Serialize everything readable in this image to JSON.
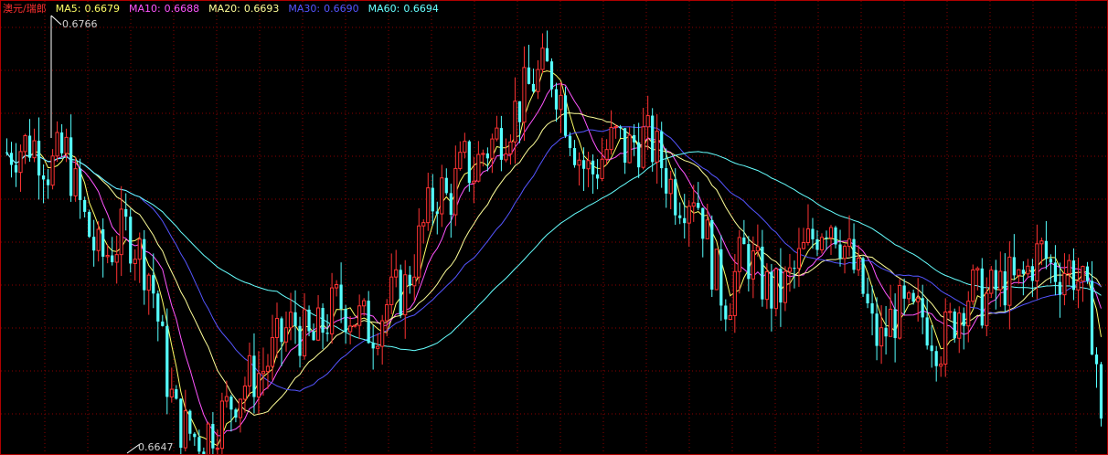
{
  "legend": {
    "symbol": "澳元/瑞郎",
    "ma5_label": "MA5:",
    "ma5_value": "0.6679",
    "ma10_label": "MA10:",
    "ma10_value": "0.6688",
    "ma20_label": "MA20:",
    "ma20_value": "0.6693",
    "ma30_label": "MA30:",
    "ma30_value": "0.6690",
    "ma60_label": "MA60:",
    "ma60_value": "0.6694"
  },
  "annotations": {
    "high_label": "0.6766",
    "low_label": "0.6647"
  },
  "colors": {
    "background": "#000000",
    "grid": "#8b0000",
    "up_candle": "#ff3333",
    "down_candle": "#55ffff",
    "ma5": "#ffff66",
    "ma10": "#ff55ff",
    "ma20": "#ffff99",
    "ma30": "#5555ff",
    "ma60": "#66ffff"
  },
  "chart_data": {
    "type": "candlestick",
    "title": "澳元/瑞郎",
    "ylim": [
      0.6645,
      0.6768
    ],
    "high": 0.6766,
    "low": 0.6647,
    "grid": true,
    "series": [
      {
        "name": "MA5",
        "last": 0.6679
      },
      {
        "name": "MA10",
        "last": 0.6688
      },
      {
        "name": "MA20",
        "last": 0.6693
      },
      {
        "name": "MA30",
        "last": 0.669
      },
      {
        "name": "MA60",
        "last": 0.6694
      }
    ],
    "close_path": [
      0.673,
      0.6731,
      0.6732,
      0.6733,
      0.673,
      0.6725,
      0.6728,
      0.673,
      0.672,
      0.6712,
      0.6705,
      0.67,
      0.6702,
      0.6705,
      0.6708,
      0.6705,
      0.67,
      0.6695,
      0.668,
      0.6665,
      0.6655,
      0.6652,
      0.665,
      0.665,
      0.6652,
      0.6655,
      0.6658,
      0.6662,
      0.6665,
      0.6667,
      0.6668,
      0.6672,
      0.6676,
      0.668,
      0.6682,
      0.6678,
      0.6676,
      0.668,
      0.6684,
      0.6688,
      0.6686,
      0.6684,
      0.6682,
      0.668,
      0.6684,
      0.6688,
      0.669,
      0.6692,
      0.67,
      0.6708,
      0.6715,
      0.672,
      0.6716,
      0.6722,
      0.6727,
      0.6724,
      0.673,
      0.6732,
      0.6735,
      0.6738,
      0.6742,
      0.6746,
      0.675,
      0.6752,
      0.6753,
      0.6748,
      0.674,
      0.6732,
      0.6726,
      0.6724,
      0.6728,
      0.6732,
      0.6734,
      0.673,
      0.6733,
      0.6734,
      0.6732,
      0.6728,
      0.6722,
      0.6718,
      0.6718,
      0.672,
      0.6712,
      0.67,
      0.6692,
      0.6688,
      0.6697,
      0.6702,
      0.6698,
      0.6694,
      0.669,
      0.669,
      0.6693,
      0.6697,
      0.6702,
      0.6706,
      0.671,
      0.6712,
      0.6708,
      0.6702,
      0.6696,
      0.669,
      0.668,
      0.6676,
      0.6682,
      0.6685,
      0.6684,
      0.6683,
      0.6684,
      0.668,
      0.6676,
      0.668,
      0.6685,
      0.669,
      0.6691,
      0.6688,
      0.669,
      0.6692,
      0.6694,
      0.6692,
      0.6695,
      0.67,
      0.6702,
      0.6698,
      0.6696,
      0.6698,
      0.6696,
      0.669,
      0.668,
      0.666
    ]
  }
}
